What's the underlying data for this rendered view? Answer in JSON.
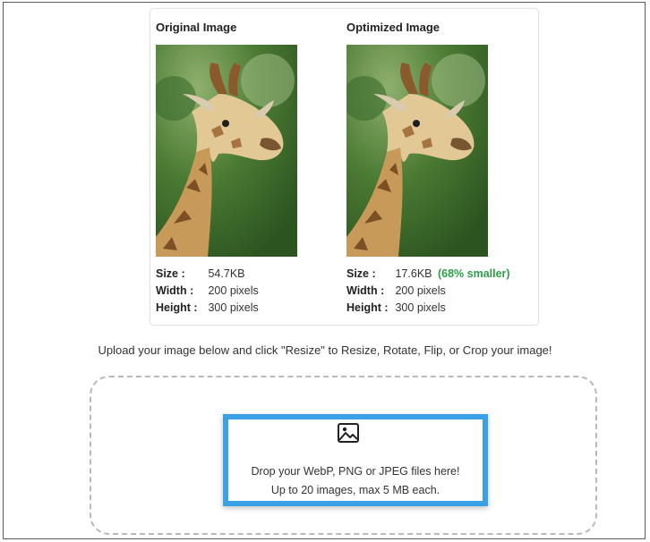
{
  "original": {
    "title": "Original Image",
    "size_label": "Size :",
    "size_value": "54.7KB",
    "width_label": "Width :",
    "width_value": "200 pixels",
    "height_label": "Height :",
    "height_value": "300 pixels"
  },
  "optimized": {
    "title": "Optimized Image",
    "size_label": "Size :",
    "size_value": "17.6KB",
    "savings": "(68% smaller)",
    "width_label": "Width :",
    "width_value": "200 pixels",
    "height_label": "Height :",
    "height_value": "300 pixels"
  },
  "instructions": "Upload your image below and click \"Resize\" to Resize, Rotate, Flip, or Crop your image!",
  "dropzone": {
    "icon": "image-icon",
    "line1": "Drop your WebP, PNG or JPEG files here!",
    "line2": "Up to 20 images, max 5 MB each."
  },
  "colors": {
    "savings": "#2e9d4a",
    "highlight_border": "#3aa0e8",
    "dashed_border": "#b9b9b9"
  }
}
